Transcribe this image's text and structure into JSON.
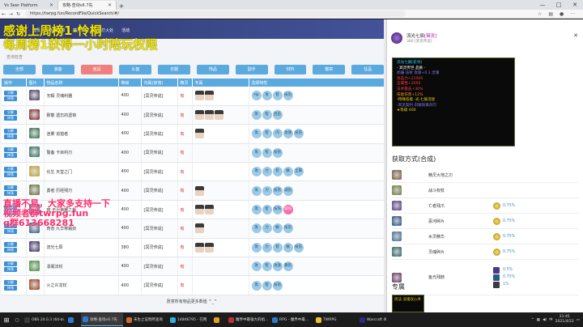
{
  "browser": {
    "tabs": [
      {
        "title": "Vs Seer Platform",
        "active": false
      },
      {
        "title": "攻略·查询v6.7先",
        "active": true
      }
    ],
    "url": "https://twrpg.fun/RecordFile/QuickSearch/#/"
  },
  "site": {
    "menu": [
      "首页",
      "物品查询",
      "魔方计算",
      "聚灯火处",
      "活动"
    ],
    "subtag": "查询检查",
    "categories": [
      "全部",
      "装备",
      "道具",
      "头盔",
      "衣服",
      "饰品",
      "副手",
      "材料",
      "徽章",
      "任品"
    ],
    "active_category": 2,
    "columns": [
      "操作",
      "图片",
      "物品名称",
      "等级",
      "归属(掉落)",
      "精灵",
      "专属",
      "选择特性"
    ],
    "op_labels": [
      "分解",
      "掉落"
    ],
    "rows": [
      {
        "name": "无暇 灵魂利器",
        "level": "400",
        "from": "[冥灵传说]",
        "spirit": "有",
        "faces": 2,
        "attrs": [
          "Hp",
          "攻",
          "智",
          "技伤"
        ],
        "color": "#3c3060"
      },
      {
        "name": "致敬 遗忘的遗荷",
        "level": "400",
        "from": "[冥灵传说]",
        "spirit": "有",
        "faces": 3,
        "attrs": [
          "攻",
          "智",
          "回击"
        ],
        "color": "#801820"
      },
      {
        "name": "迷雾 追猎者",
        "level": "400",
        "from": "[冥灵传说]",
        "spirit": "有",
        "faces": 1,
        "attrs": [
          "攻",
          "智",
          "闪",
          "攻速",
          "技伤"
        ],
        "color": "#2a6a40"
      },
      {
        "name": "警备 卡目利刃",
        "level": "400",
        "from": "[冥灵传说]",
        "spirit": "有",
        "faces": 0,
        "attrs": [
          "攻",
          "智",
          "技伤"
        ],
        "color": "#206a50"
      },
      {
        "name": "化生 天堂之门",
        "level": "400",
        "from": "[冥灵传说]",
        "spirit": "有",
        "faces": 0,
        "attrs": [
          "攻",
          "力",
          "智",
          "敏",
          "全属"
        ],
        "color": "#b8a020"
      },
      {
        "name": "勇者 历经残刃",
        "level": "400",
        "from": "[冥灵传说]",
        "spirit": "有",
        "faces": 1,
        "attrs": [
          "攻",
          "力",
          "技伤",
          "减伤"
        ],
        "color": "#606a30"
      },
      {
        "name": "暗 无尽荣耀之枪",
        "level": "400",
        "from": "[冥灵传说]",
        "spirit": "有",
        "faces": 2,
        "attrs": [
          "攻",
          "智",
          "技伤",
          "减伤"
        ],
        "color": "#603070"
      },
      {
        "name": "奇态 九华寒霜剑",
        "level": "400",
        "from": "[冥灵传说]",
        "spirit": "有",
        "faces": 1,
        "attrs": [
          "攻",
          "力",
          "敏",
          "技伤"
        ],
        "color": "#305080"
      },
      {
        "name": "流光七辰",
        "level": "380",
        "from": "[冥灵传说]",
        "spirit": "有",
        "faces": 2,
        "attrs": [
          "攻",
          "力",
          "智",
          "敏",
          "技伤"
        ],
        "color": "#302060"
      },
      {
        "name": "凛阁法杖",
        "level": "400",
        "from": "[冥灵传说]",
        "spirit": "有",
        "faces": 0,
        "attrs": [
          "攻",
          "智",
          "攻速",
          "暴伤"
        ],
        "color": "#3a8a30"
      },
      {
        "name": "火之炎龙杖",
        "level": "400",
        "from": "[冥灵传说]",
        "spirit": "有",
        "faces": 0,
        "attrs": [
          "攻",
          "智",
          "技伤"
        ],
        "color": "#a03010"
      }
    ],
    "footer": "愿意所有物品更多数值 ^_^"
  },
  "stream_overlay": {
    "line1": "感谢上周榜1-怜桐",
    "line2": "每周榜1获得一小时陪玩权限",
    "line3": "直播不易，大家多支持一下",
    "line4": "视频者群twrpg.fun",
    "line5": "q群613668281"
  },
  "panel": {
    "name": "流光七辰",
    "tag": "[冥灵]",
    "sub": "380 [冥灵传说]",
    "tooltip": [
      {
        "t": "流光七辰[史诗]",
        "c": "#2ad0ff"
      },
      {
        "t": "- 冥灵传世 品质 -",
        "c": "#ffffff"
      },
      {
        "t": "武器·法杖 攻速+0.1 灵魂",
        "c": "#8080ff"
      },
      {
        "t": "攻击力+21000",
        "c": "#ff4040"
      },
      {
        "t": "全属性+2050",
        "c": "#ff4040"
      },
      {
        "t": "法术暴击+30%",
        "c": "#ff4040"
      },
      {
        "t": "技能伤害+12%",
        "c": "#ff8a2a"
      },
      {
        "t": "-特殊技能 ·光·七辰流星",
        "c": "#e8d000"
      },
      {
        "t": "-冥灵契约 白银剑锋剑刃",
        "c": "#8080ff"
      },
      {
        "t": "★等级 400",
        "c": "#e8d000"
      }
    ],
    "sources_title": "获取方式(合成)",
    "sources": [
      {
        "name": "精灵大地之刃",
        "pct": "",
        "color": "#7a5030"
      },
      {
        "name": "战斗权杖",
        "pct": "",
        "color": "#6a7a30"
      },
      {
        "name": "亡者残爪",
        "pct": "0.75%",
        "color": "#503090"
      },
      {
        "name": "恶河碎片",
        "pct": "0.75%",
        "color": "#1a4a8a"
      },
      {
        "name": "水灵精华",
        "pct": "0.75%",
        "color": "#3a6aa0"
      },
      {
        "name": "灵魂碎片",
        "pct": "0.75%",
        "color": "#206060"
      },
      {
        "name": "鱼光残骸",
        "pct": "",
        "multi": [
          "0.5%",
          "0.75%",
          "1%"
        ],
        "color": "#603060"
      }
    ],
    "owner_title": "专属",
    "owner_card": "风法 渲魂双心术"
  },
  "taskbar": {
    "apps": [
      {
        "title": "OBS 24.0.3 (64-bi...",
        "color": "#3a3a3a",
        "active": false
      },
      {
        "title": "",
        "color": "#2c7ad6",
        "active": false
      },
      {
        "title": "攻略·查询v6.7先",
        "color": "#2c7ad6",
        "active": true
      },
      {
        "title": "未生之证明所查询",
        "color": "#d06a2a",
        "active": false
      },
      {
        "title": "14846795 - 在网",
        "color": "#2ab0e0",
        "active": false
      },
      {
        "title": "",
        "color": "#e0a020",
        "active": false
      },
      {
        "title": "魔界中最强大的组...",
        "color": "#c03030",
        "active": false
      },
      {
        "title": "RPG - 魔界中最...",
        "color": "#2a7ad0",
        "active": false
      },
      {
        "title": "TWRPG",
        "color": "#f0c030",
        "active": false
      },
      {
        "title": "Warcraft III",
        "color": "#2a2a8a",
        "active": false
      }
    ],
    "time": "21:45",
    "date": "2021/4/22",
    "ime": "中"
  }
}
